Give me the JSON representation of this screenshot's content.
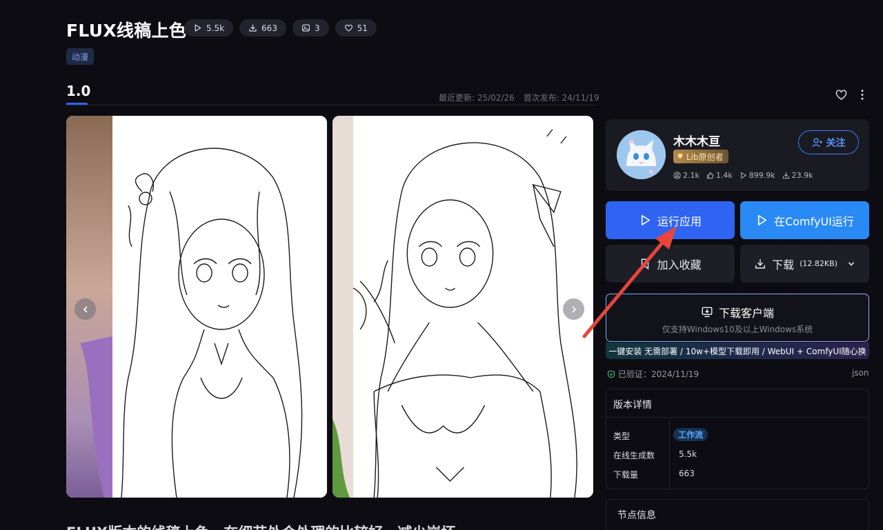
{
  "header": {
    "title": "FLUX线稿上色",
    "stats": [
      {
        "icon": "play-icon",
        "value": "5.5k"
      },
      {
        "icon": "download-icon",
        "value": "663"
      },
      {
        "icon": "image-icon",
        "value": "3"
      },
      {
        "icon": "heart-icon",
        "value": "51"
      }
    ],
    "tag": "动漫"
  },
  "version": {
    "label": "1.0",
    "updated": "最近更新: 25/02/26",
    "published": "首次发布: 24/11/19"
  },
  "gallery": {
    "images": [
      {
        "name": "lineart-girl-flower"
      },
      {
        "name": "lineart-girl-ribbon"
      }
    ]
  },
  "description": "FLUX版本的线稿上色，在细节处会处理的比较好，减少崩坏",
  "author": {
    "name": "木木木亘",
    "badge": "Lib原创者",
    "stats": [
      {
        "icon": "user-icon",
        "value": "2.1k"
      },
      {
        "icon": "thumb-up-icon",
        "value": "1.4k"
      },
      {
        "icon": "play-icon",
        "value": "899.9k"
      },
      {
        "icon": "download-icon",
        "value": "23.9k"
      }
    ],
    "follow_label": "关注"
  },
  "actions": {
    "run": "运行应用",
    "comfy": "在ComfyUI运行",
    "favorite": "加入收藏",
    "download": "下载",
    "download_size": "(12.82KB)"
  },
  "client": {
    "title": "下载客户端",
    "subtitle": "仅支持Windows10及以上Windows系统",
    "banner": "一键安装 无需部署 / 10w+模型下载即用 / WebUI + ComfyUI随心换"
  },
  "verified": "已验证：2024/11/19",
  "json_label": "json",
  "details": {
    "heading": "版本详情",
    "rows": [
      {
        "label": "类型",
        "value": "工作流"
      },
      {
        "label": "在线生成数",
        "value": "5.5k"
      },
      {
        "label": "下载量",
        "value": "663"
      }
    ]
  },
  "nodes": {
    "heading": "节点信息"
  },
  "colors": {
    "accent": "#2f64f2",
    "comfy": "#2a8af5",
    "annotation_arrow": "#e8453c"
  }
}
